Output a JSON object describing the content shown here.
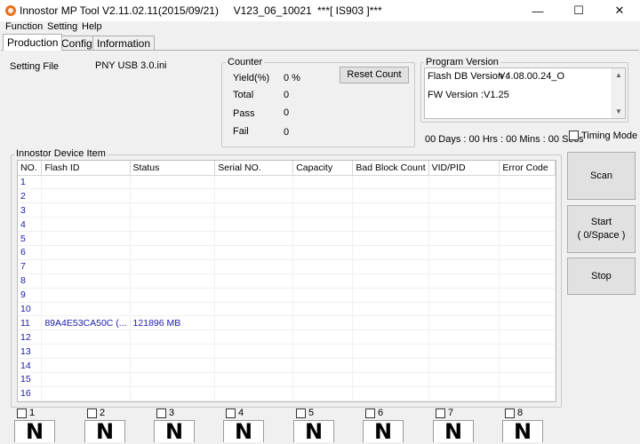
{
  "window": {
    "title": "Innostor MP Tool V2.11.02.11(2015/09/21)     V123_06_10021",
    "title_center": "***[ IS903 ]***",
    "minimize_glyph": "—",
    "maximize_glyph": "☐",
    "close_glyph": "✕"
  },
  "menu": [
    "Function",
    "Setting",
    "Help"
  ],
  "tabs": [
    "Production",
    "Config",
    "Information"
  ],
  "setting_file": {
    "label": "Setting File",
    "value": "PNY USB 3.0.ini"
  },
  "counter": {
    "title": "Counter",
    "yield_label": "Yield(%)",
    "yield_value": "0 %",
    "total_label": "Total",
    "total_value": "0",
    "pass_label": "Pass",
    "pass_value": "0",
    "fail_label": "Fail",
    "fail_value": "0",
    "reset_button": "Reset Count"
  },
  "program_version": {
    "title": "Program Version",
    "flash_db_label": "Flash DB Version :",
    "flash_db_value": "V4.08.00.24_O",
    "fw_label": "FW Version :",
    "fw_value": "V1.25"
  },
  "timer": "00 Days : 00 Hrs : 00 Mins : 00 Secs",
  "timing_mode_label": "Timing Mode",
  "device_group_title": "Innostor Device Item",
  "grid": {
    "columns": [
      "NO.",
      "Flash ID",
      "Status",
      "Serial NO.",
      "Capacity",
      "Bad Block Count",
      "VID/PID",
      "Error Code"
    ],
    "rows": [
      [
        "1",
        "",
        "",
        "",
        "",
        "",
        "",
        ""
      ],
      [
        "2",
        "",
        "",
        "",
        "",
        "",
        "",
        ""
      ],
      [
        "3",
        "",
        "",
        "",
        "",
        "",
        "",
        ""
      ],
      [
        "4",
        "",
        "",
        "",
        "",
        "",
        "",
        ""
      ],
      [
        "5",
        "",
        "",
        "",
        "",
        "",
        "",
        ""
      ],
      [
        "6",
        "",
        "",
        "",
        "",
        "",
        "",
        ""
      ],
      [
        "7",
        "",
        "",
        "",
        "",
        "",
        "",
        ""
      ],
      [
        "8",
        "",
        "",
        "",
        "",
        "",
        "",
        ""
      ],
      [
        "9",
        "",
        "",
        "",
        "",
        "",
        "",
        ""
      ],
      [
        "10",
        "",
        "",
        "",
        "",
        "",
        "",
        ""
      ],
      [
        "11",
        "89A4E53CA50C (...",
        "121896 MB",
        "",
        "",
        "",
        "",
        ""
      ],
      [
        "12",
        "",
        "",
        "",
        "",
        "",
        "",
        ""
      ],
      [
        "13",
        "",
        "",
        "",
        "",
        "",
        "",
        ""
      ],
      [
        "14",
        "",
        "",
        "",
        "",
        "",
        "",
        ""
      ],
      [
        "15",
        "",
        "",
        "",
        "",
        "",
        "",
        ""
      ],
      [
        "16",
        "",
        "",
        "",
        "",
        "",
        "",
        ""
      ]
    ]
  },
  "buttons": {
    "scan": "Scan",
    "start_line1": "Start",
    "start_line2": "( 0/Space )",
    "stop": "Stop"
  },
  "ports": [
    {
      "label": "1",
      "glyph": "N"
    },
    {
      "label": "2",
      "glyph": "N"
    },
    {
      "label": "3",
      "glyph": "N"
    },
    {
      "label": "4",
      "glyph": "N"
    },
    {
      "label": "5",
      "glyph": "N"
    },
    {
      "label": "6",
      "glyph": "N"
    },
    {
      "label": "7",
      "glyph": "N"
    },
    {
      "label": "8",
      "glyph": "N"
    }
  ],
  "colors": {
    "grid_text": "#1a1aa6",
    "app_icon": "#e8711a"
  }
}
